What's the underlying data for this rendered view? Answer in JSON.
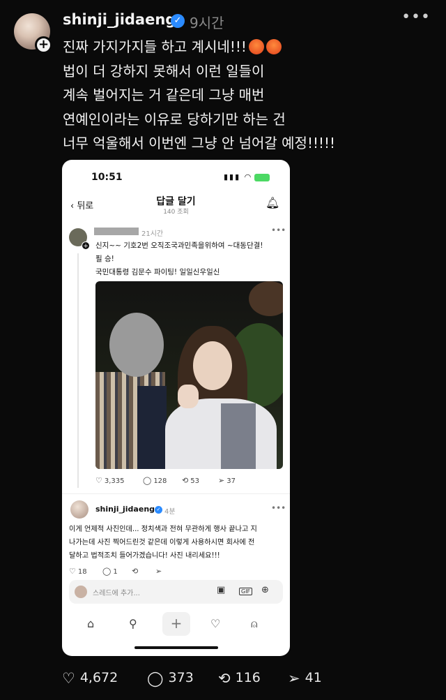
{
  "post": {
    "username": "shinji_jidaeng",
    "time": "9시간",
    "more": "•••",
    "lines": [
      "진짜 가지가지들 하고 계시네!!!",
      "법이 더 강하지 못해서 이런 일들이",
      "계속 벌어지는 거 같은데 그냥 매번",
      "연예인이라는 이유로 당하기만 하는 건",
      "너무 억울해서 이번엔 그냥 안 넘어갈 예정!!!!!"
    ],
    "actions": {
      "likes": "4,672",
      "comments": "373",
      "reposts": "116",
      "shares": "41"
    }
  },
  "screenshot": {
    "status_time": "10:51",
    "back_label": "뒤로",
    "title": "답글 달기",
    "views": "140 조회",
    "reply": {
      "time": "21시간",
      "lines": [
        "신지~~ 기호2번 오직조국과민족을위하여 ~대동단결!",
        "필 승!",
        "국민대통령 김문수 파이팅! 일일신우일신"
      ],
      "stats": {
        "likes": "3,335",
        "comments": "128",
        "reposts": "53",
        "shares": "37"
      }
    },
    "my_reply": {
      "username": "shinji_jidaeng",
      "time": "4분",
      "lines": [
        "이게 언제적 사진인데... 정치색과 전혀 무관하게 행사 끝나고 지",
        "나가는데 사진 찍어드린것 같은데 이렇게 사용하시면 회사에 전",
        "달하고 법적조치 들어가겠습니다! 사진 내리세요!!!"
      ],
      "stats": {
        "likes": "18",
        "comments": "1"
      }
    },
    "composer_placeholder": "스레드에 추가...",
    "gif_label": "GIF"
  },
  "icons": {
    "verified": "verified-badge-icon",
    "heart": "heart-icon",
    "comment": "comment-icon",
    "repost": "repost-icon",
    "share": "send-icon"
  },
  "colors": {
    "background": "#0a0a0a",
    "verified": "#2b8bff",
    "text": "#f3f3f3",
    "muted": "#8a8a8a"
  }
}
